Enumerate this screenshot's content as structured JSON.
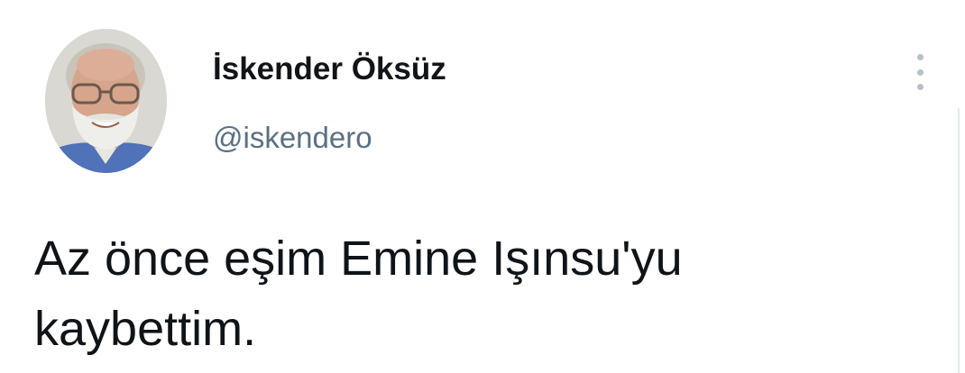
{
  "author": {
    "display_name": "İskender Öksüz",
    "handle": "@iskendero",
    "avatar_icon": "profile-photo"
  },
  "tweet": {
    "text": "Az önce eşim Emine Işınsu'yu\nkaybettim."
  },
  "actions": {
    "more_icon": "vertical-ellipsis-icon"
  },
  "colors": {
    "name_text": "#111418",
    "handle_text": "#5b7083",
    "body_text": "#0f1419",
    "more_dots": "#b8c0c8"
  }
}
